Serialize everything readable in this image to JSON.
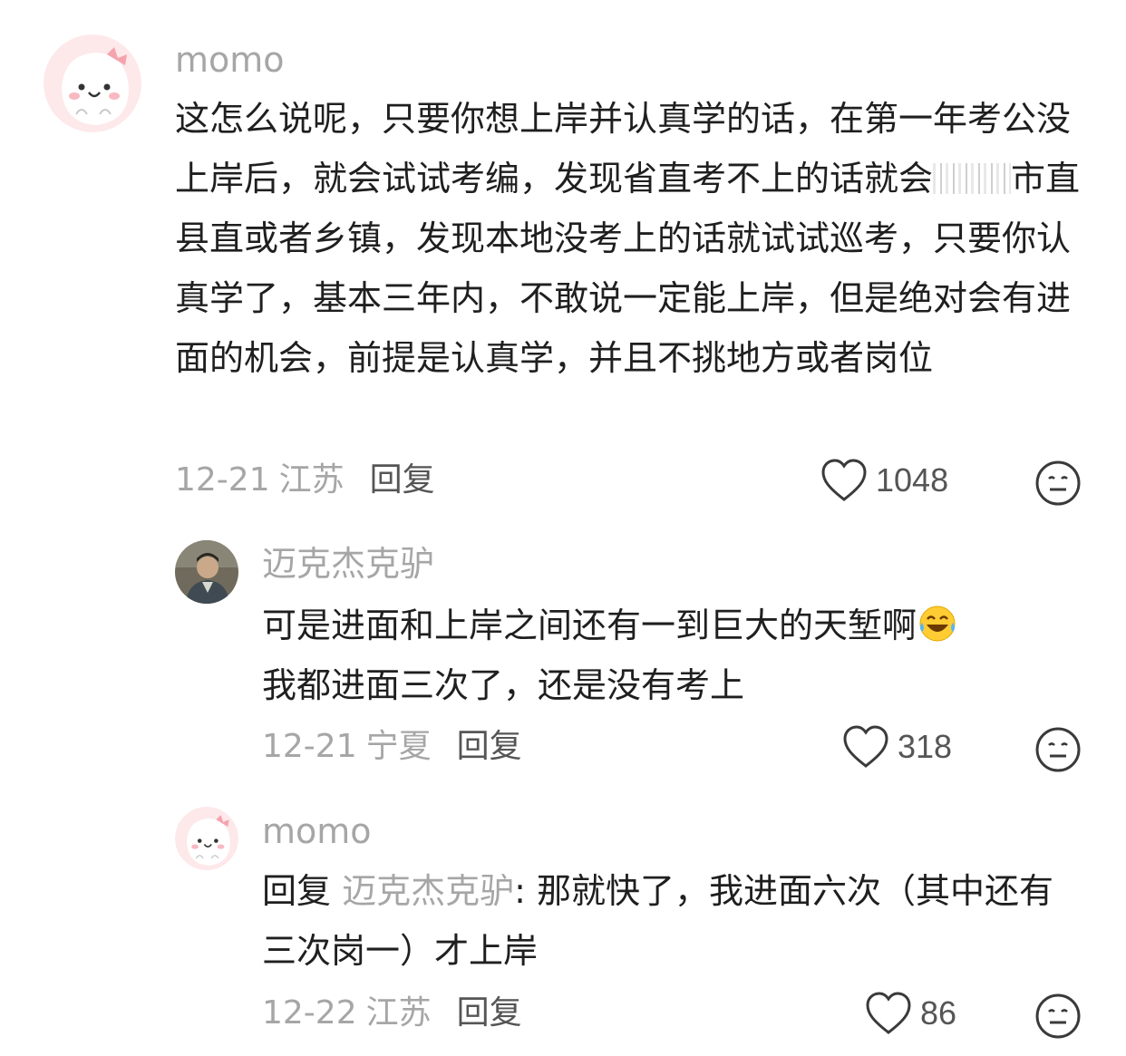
{
  "comments": [
    {
      "username": "momo",
      "text_parts": [
        "这怎么说呢，只要你想上岸并认真学的话，在第一年考公没上岸后，就会试试考编，发现省直考不上的话就会",
        "市直 县直或者乡镇，发现本地没考上的话就试试巡考，只要你认真学了，基本三年内，不敢说一定能上岸，但是绝对会有进面的机会，前提是认真学，并且不挑地方或者岗位"
      ],
      "date": "12-21",
      "location": "江苏",
      "reply_label": "回复",
      "likes": "1048"
    },
    {
      "username": "迈克杰克驴",
      "text": "可是进面和上岸之间还有一到巨大的天堑啊",
      "text_line2": "我都进面三次了，还是没有考上",
      "date": "12-21",
      "location": "宁夏",
      "reply_label": "回复",
      "likes": "318"
    },
    {
      "username": "momo",
      "reply_prefix": "回复",
      "reply_target": "迈克杰克驴",
      "text": ": 那就快了，我进面六次（其中还有三次岗一）才上岸",
      "date": "12-22",
      "location": "江苏",
      "reply_label": "回复",
      "likes": "86"
    }
  ],
  "colors": {
    "secondary_text": "#a6a6a6",
    "primary_text": "#1f1f1f",
    "avatar_pink": "#fde4e6"
  },
  "icons": [
    "like-heart-icon",
    "reaction-face-icon",
    "laughing-tears-emoji"
  ]
}
